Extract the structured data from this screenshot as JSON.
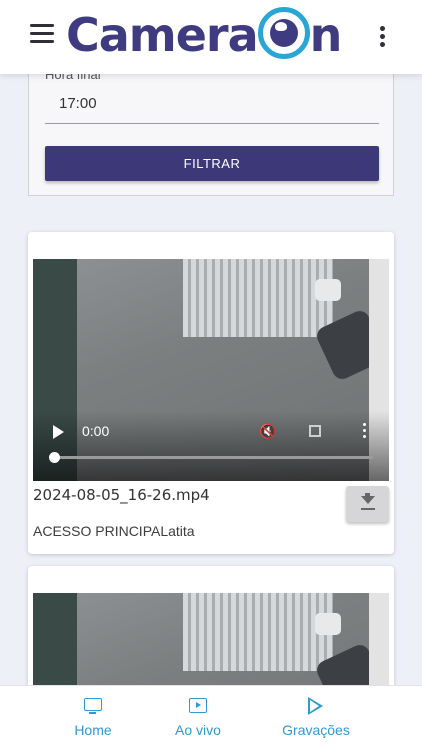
{
  "header": {
    "logo_text": "Camera",
    "logo_text_end": "n",
    "colors": {
      "brand": "#3f3b80",
      "accent": "#2aa6d6"
    }
  },
  "filter": {
    "end_time_label": "Hora final",
    "end_time_value": "17:00",
    "filter_button": "FILTRAR"
  },
  "recordings": [
    {
      "file_name": "2024-08-05_16-26.mp4",
      "camera": "ACESSO PRINCIPALatita",
      "time": "0:00"
    },
    {
      "file_name": "",
      "camera": ""
    }
  ],
  "bottom_nav": {
    "items": [
      {
        "label": "Home",
        "icon": "monitor-icon"
      },
      {
        "label": "Ao vivo",
        "icon": "video-icon"
      },
      {
        "label": "Gravações",
        "icon": "play-icon"
      }
    ],
    "color": "#2f9ad0"
  }
}
